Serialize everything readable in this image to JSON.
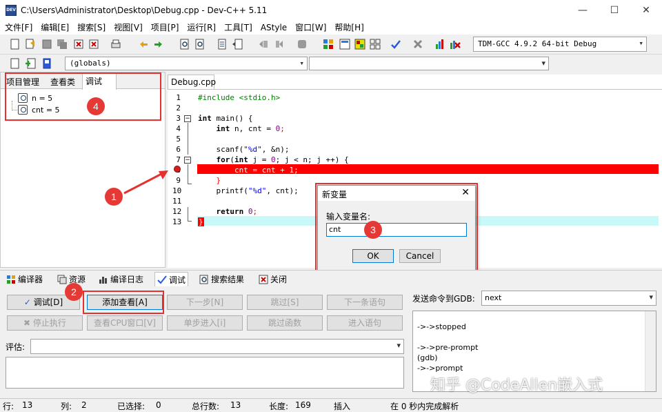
{
  "window": {
    "title": "C:\\Users\\Administrator\\Desktop\\Debug.cpp - Dev-C++ 5.11",
    "app_icon_text": "DEV"
  },
  "menu": [
    "文件[F]",
    "编辑[E]",
    "搜索[S]",
    "视图[V]",
    "项目[P]",
    "运行[R]",
    "工具[T]",
    "AStyle",
    "窗口[W]",
    "帮助[H]"
  ],
  "toolbar": {
    "compiler": "TDM-GCC 4.9.2 64-bit Debug",
    "scope": "(globals)",
    "members": ""
  },
  "left_panel": {
    "tabs": [
      "项目管理",
      "查看类",
      "调试"
    ],
    "active_tab": "调试",
    "watches": [
      "n = 5",
      "cnt = 5"
    ]
  },
  "editor": {
    "tab": "Debug.cpp",
    "line_numbers": [
      "1",
      "2",
      "3",
      "4",
      "5",
      "6",
      "7",
      "8",
      "9",
      "10",
      "11",
      "12",
      "13"
    ],
    "code_lines": {
      "l1": "#include <stdio.h>",
      "l3a": "int",
      "l3b": " main() {",
      "l4a": "    int",
      "l4b": " n, cnt = ",
      "l4c": "0",
      "l4d": ";",
      "l6a": "    scanf(",
      "l6b": "\"%d\"",
      "l6c": ", &n);",
      "l7a": "    for",
      "l7b": "(",
      "l7c": "int",
      "l7d": " j = ",
      "l7e": "0",
      "l7f": "; j < n; j ++) {",
      "l8": "        cnt = cnt + 1;",
      "l9": "    }",
      "l10a": "    printf(",
      "l10b": "\"%d\"",
      "l10c": ", cnt);",
      "l12a": "    return",
      "l12b": " 0",
      "l12c": ";",
      "l13": "}"
    }
  },
  "dialog": {
    "title": "新变量",
    "label": "输入变量名:",
    "value": "cnt",
    "ok": "OK",
    "cancel": "Cancel"
  },
  "bottom_tabs": [
    "编译器",
    "资源",
    "编译日志",
    "调试",
    "搜索结果",
    "关闭"
  ],
  "debug_buttons": {
    "debug": "调试[D]",
    "add_watch": "添加查看[A]",
    "next_step": "下一步[N]",
    "skip": "跳过[S]",
    "next_stmt": "下一条语句",
    "stop": "停止执行",
    "cpu_window": "查看CPU窗口[V]",
    "step_into": "单步进入[i]",
    "skip_func": "跳过函数",
    "into_stmt": "进入语句"
  },
  "gdb": {
    "label": "发送命令到GDB:",
    "command": "next",
    "output": [
      "->->stopped",
      "",
      "->->pre-prompt",
      "(gdb)",
      "->->prompt"
    ]
  },
  "eval": {
    "label": "评估:"
  },
  "status": {
    "row_label": "行:",
    "row": "13",
    "col_label": "列:",
    "col": "2",
    "sel_label": "已选择:",
    "sel": "0",
    "total_label": "总行数:",
    "total": "13",
    "len_label": "长度:",
    "len": "169",
    "mode": "插入",
    "parse": "在 0 秒内完成解析"
  },
  "annotations": [
    "1",
    "2",
    "3",
    "4"
  ],
  "watermark": "知乎 @CodeAllen嵌入式",
  "colors": {
    "highlight_red": "#ff0000",
    "highlight_cyan": "#c8f8f8",
    "annotation": "#e53935"
  }
}
